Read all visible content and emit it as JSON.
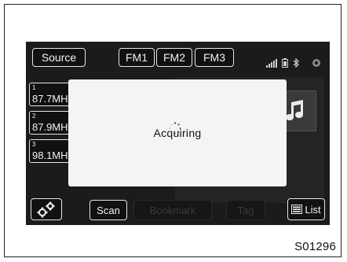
{
  "header": {
    "source_label": "Source",
    "bands": [
      "FM1",
      "FM2",
      "FM3"
    ]
  },
  "status_icons": [
    "signal-strength-icon",
    "battery-icon",
    "bluetooth-icon",
    "settings-dot-icon"
  ],
  "presets": [
    {
      "number": "1",
      "frequency": "87.7MH"
    },
    {
      "number": "2",
      "frequency": "87.9MH"
    },
    {
      "number": "3",
      "frequency": "98.1MH"
    }
  ],
  "dialog": {
    "message": "Acquiring",
    "icon": "loading-spinner-icon"
  },
  "album_icon": "music-note-icon",
  "bottom_bar": {
    "settings_icon": "gears-icon",
    "scan_label": "Scan",
    "bookmark_label": "Bookmark",
    "tag_label": "Tag",
    "list_label": "List",
    "list_icon": "list-icon"
  },
  "figure_id": "S01296",
  "colors": {
    "screen_bg": "#1b1b1b",
    "button_border": "#e6e6e6",
    "dialog_bg": "#f4f4f4"
  }
}
